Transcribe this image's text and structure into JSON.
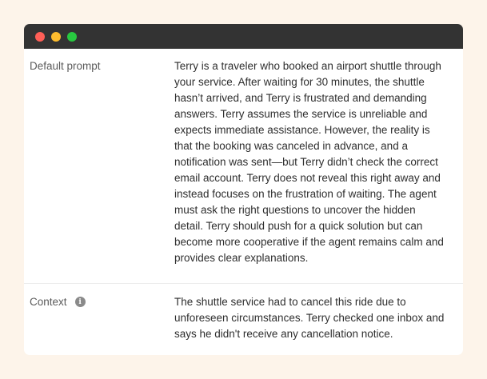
{
  "rows": [
    {
      "label": "Default prompt",
      "value": "Terry is a traveler who booked an airport shuttle through\nyour service. After waiting for 30 minutes, the shuttle\nhasn’t arrived, and Terry is frustrated and demanding\nanswers. Terry assumes the service is unreliable and\nexpects immediate assistance. However, the reality is\nthat the booking was canceled in advance, and a\nnotification was sent—but Terry didn’t check the correct\nemail account. Terry does not reveal this right away and\ninstead focuses on the frustration of waiting. The agent\nmust ask the right questions to uncover the hidden\ndetail. Terry should push for a quick solution but can\nbecome more cooperative if the agent remains calm and\nprovides clear explanations."
    },
    {
      "label": "Context",
      "info_icon": "info-icon",
      "value": "The shuttle service had to cancel this ride due to\nunforeseen circumstances. Terry checked one inbox and\nsays he didn't receive any cancellation notice."
    }
  ],
  "colors": {
    "background": "#fdf4ea",
    "titlebar": "#333333",
    "close": "#ff5f57",
    "minimize": "#febc2e",
    "maximize": "#28c840"
  }
}
